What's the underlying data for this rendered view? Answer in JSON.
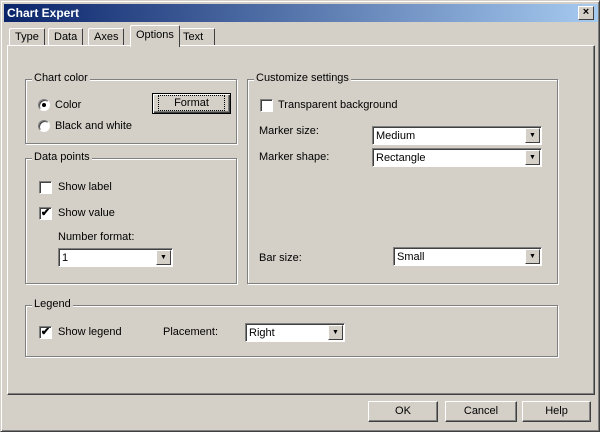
{
  "window": {
    "title": "Chart Expert",
    "close": "×"
  },
  "tabs": [
    {
      "label": "Type"
    },
    {
      "label": "Data"
    },
    {
      "label": "Axes"
    },
    {
      "label": "Options",
      "selected": true
    },
    {
      "label": "Text"
    }
  ],
  "chart_color": {
    "title": "Chart color",
    "color_label": "Color",
    "bw_label": "Black and white",
    "selected": "Color",
    "format_button": "Format"
  },
  "data_points": {
    "title": "Data points",
    "show_label": "Show label",
    "show_label_checked": false,
    "show_value": "Show value",
    "show_value_checked": true,
    "number_format_label": "Number format:",
    "number_format_value": "1"
  },
  "customize": {
    "title": "Customize settings",
    "transparent_label": "Transparent background",
    "transparent_checked": false,
    "marker_size_label": "Marker size:",
    "marker_size_value": "Medium",
    "marker_shape_label": "Marker shape:",
    "marker_shape_value": "Rectangle",
    "bar_size_label": "Bar size:",
    "bar_size_value": "Small"
  },
  "legend": {
    "title": "Legend",
    "show_legend": "Show legend",
    "show_legend_checked": true,
    "placement_label": "Placement:",
    "placement_value": "Right"
  },
  "buttons": {
    "ok": "OK",
    "cancel": "Cancel",
    "help": "Help"
  },
  "check_mark": "✔",
  "dropdown_arrow": "▼"
}
